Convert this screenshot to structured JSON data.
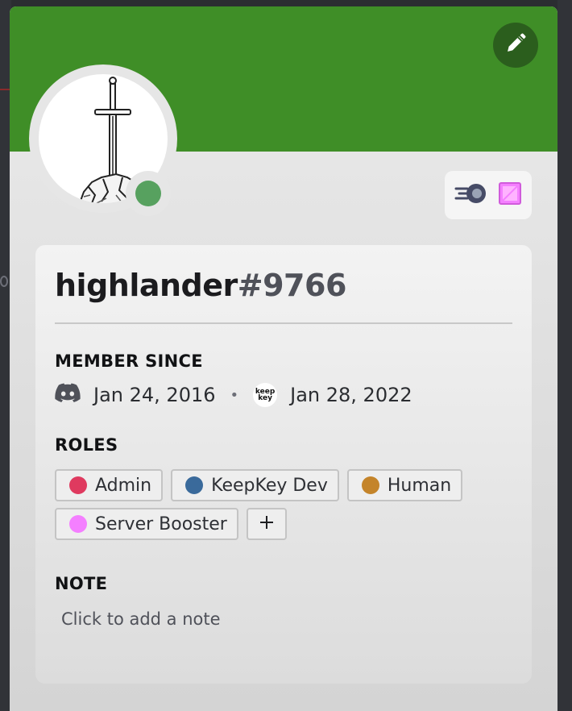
{
  "profile": {
    "username": "highlander",
    "discriminator": "#9766",
    "status": "online",
    "banner_color": "#3f8e27",
    "status_color": "#57a15f"
  },
  "edit_button": {
    "icon": "pencil-icon"
  },
  "badges": [
    {
      "name": "hypesquad-speed-badge",
      "icon": "speed-orb-icon"
    },
    {
      "name": "nitro-boost-gem-badge",
      "icon": "pink-gem-icon"
    }
  ],
  "member_since": {
    "title": "MEMBER SINCE",
    "discord_icon": "discord-logo-icon",
    "discord_date": "Jan 24, 2016",
    "separator": "•",
    "server_icon_text": "keep key",
    "server_date": "Jan 28, 2022"
  },
  "roles": {
    "title": "ROLES",
    "items": [
      {
        "label": "Admin",
        "color": "#df3a5f"
      },
      {
        "label": "KeepKey Dev",
        "color": "#3a6a9b"
      },
      {
        "label": "Human",
        "color": "#c4842a"
      },
      {
        "label": "Server Booster",
        "color": "#f47fff"
      }
    ],
    "add_icon": "plus-icon"
  },
  "note": {
    "title": "NOTE",
    "placeholder": "Click to add a note"
  }
}
